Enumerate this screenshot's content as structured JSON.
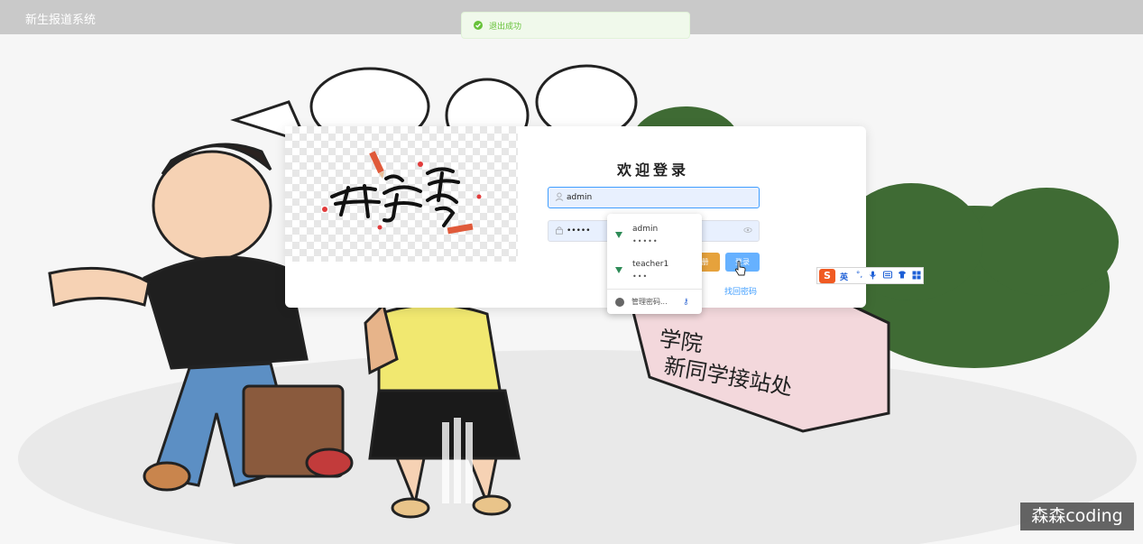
{
  "app": {
    "title": "新生报道系统"
  },
  "toast": {
    "message": "退出成功"
  },
  "login": {
    "title": "欢迎登录",
    "username_value": "admin",
    "password_value": "•••••",
    "register_label": "册",
    "login_label": "登录",
    "find_password": "找回密码"
  },
  "autofill": {
    "entries": [
      {
        "username": "admin",
        "password_mask": "•••••"
      },
      {
        "username": "teacher1",
        "password_mask": "•••"
      }
    ],
    "manage_label": "管理密码..."
  },
  "ime": {
    "lang_label": "英"
  },
  "watermark": {
    "text": "森森coding"
  },
  "colors": {
    "primary": "#409eff",
    "warning": "#e6a23c",
    "success": "#67c23a",
    "topbar": "#c9c9c9"
  },
  "icons": [
    "check-circle-icon",
    "user-icon",
    "lock-icon",
    "eye-icon",
    "key-icon",
    "google-icon",
    "mic-icon",
    "keyboard-icon",
    "shirt-icon",
    "grid-icon",
    "sogou-logo-icon"
  ]
}
